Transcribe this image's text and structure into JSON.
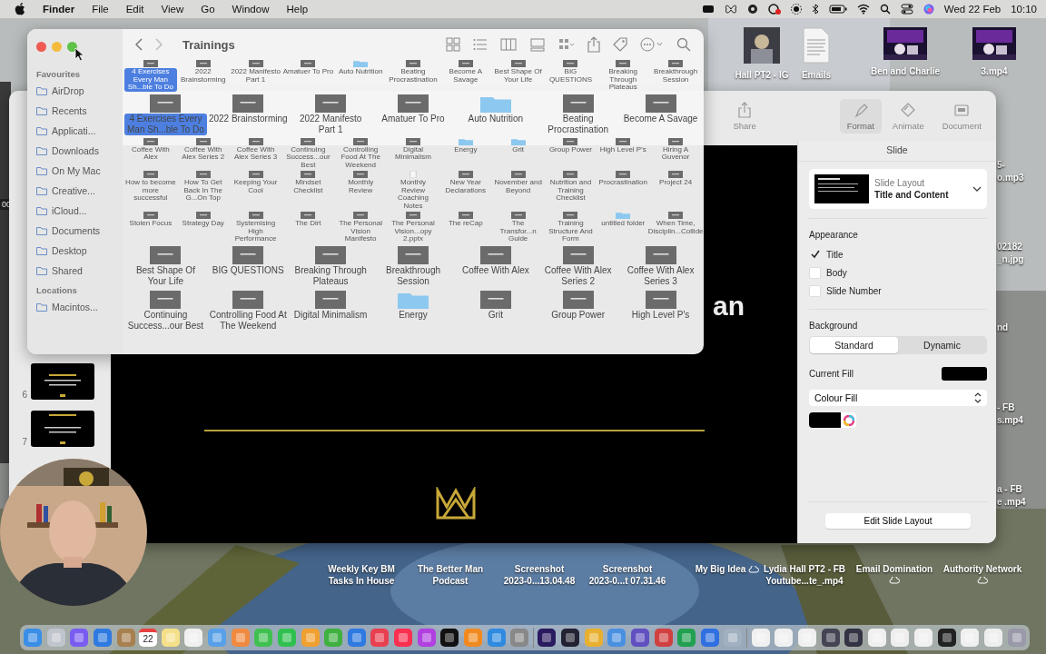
{
  "menu_bar": {
    "app_name": "Finder",
    "menus": [
      "File",
      "Edit",
      "View",
      "Go",
      "Window",
      "Help"
    ],
    "date": "Wed 22 Feb",
    "time": "10:10"
  },
  "desktop": {
    "top_icons": [
      {
        "label": "Hall PT2 - IG"
      },
      {
        "label": "Emails",
        "kind": "document"
      },
      {
        "label": "Ben and Charlie",
        "kind": "video"
      },
      {
        "label": "3.mp4",
        "kind": "video"
      }
    ],
    "edge_labels": [
      "5-",
      "o.mp3",
      "02182",
      "_n.jpg",
      "nd",
      "- FB",
      "s.mp4",
      "a - FB",
      "e .mp4"
    ],
    "left_edge_text": "00",
    "bottom_icons": [
      {
        "lines": [
          "Weekly Key BM",
          "Tasks In House"
        ],
        "cloud": false
      },
      {
        "lines": [
          "The Better Man",
          "Podcast"
        ],
        "cloud": false
      },
      {
        "lines": [
          "Screenshot",
          "2023-0...13.04.48"
        ],
        "cloud": false
      },
      {
        "lines": [
          "Screenshot",
          "2023-0...t 07.31.46"
        ],
        "cloud": false
      },
      {
        "lines": [
          "My Big Idea"
        ],
        "cloud": true
      },
      {
        "lines": [
          "Lydia Hall PT2 - FB",
          "Youtube...te_.mp4"
        ],
        "cloud": false
      },
      {
        "lines": [
          "Email Domination"
        ],
        "cloud": true
      },
      {
        "lines": [
          "Authority Network"
        ],
        "cloud": true
      }
    ]
  },
  "keynote": {
    "toolbar": [
      {
        "label": "Share",
        "selected": false
      },
      {
        "label": "Format",
        "selected": true
      },
      {
        "label": "Animate",
        "selected": false
      },
      {
        "label": "Document",
        "selected": false
      }
    ],
    "slide_numbers": [
      "6",
      "7"
    ],
    "canvas": {
      "title_fragment": "an"
    },
    "inspector": {
      "header": "Slide",
      "layout_label": "Slide Layout",
      "layout_name": "Title and Content",
      "appearance_heading": "Appearance",
      "appearance": [
        {
          "label": "Title",
          "checked": true
        },
        {
          "label": "Body",
          "checked": false
        },
        {
          "label": "Slide Number",
          "checked": false
        }
      ],
      "background_heading": "Background",
      "background_modes": [
        {
          "label": "Standard",
          "selected": true
        },
        {
          "label": "Dynamic",
          "selected": false
        }
      ],
      "current_fill_label": "Current Fill",
      "fill_type": "Colour Fill",
      "edit_button": "Edit Slide Layout"
    }
  },
  "finder": {
    "title": "Trainings",
    "sidebar": [
      {
        "label": "Favourites",
        "kind": "heading"
      },
      {
        "label": "AirDrop",
        "kind": "item"
      },
      {
        "label": "Recents",
        "kind": "item"
      },
      {
        "label": "Applicati...",
        "kind": "item"
      },
      {
        "label": "Downloads",
        "kind": "item"
      },
      {
        "label": "On My Mac",
        "kind": "item"
      },
      {
        "label": "Creative...",
        "kind": "item"
      },
      {
        "label": "iCloud...",
        "kind": "item"
      },
      {
        "label": "Documents",
        "kind": "item"
      },
      {
        "label": "Desktop",
        "kind": "item"
      },
      {
        "label": "Shared",
        "kind": "item"
      },
      {
        "label": "Locations",
        "kind": "heading"
      },
      {
        "label": "Macintos...",
        "kind": "item"
      }
    ],
    "small_rows": [
      [
        {
          "label": "4 Exercises Every Man Sh...ble To Do",
          "kind": "presentation",
          "selected": true
        },
        {
          "label": "2022 Brainstorming",
          "kind": "presentation",
          "selected": false
        },
        {
          "label": "2022 Manifesto Part 1",
          "kind": "presentation",
          "selected": false
        },
        {
          "label": "Amatuer To Pro",
          "kind": "presentation",
          "selected": false
        },
        {
          "label": "Auto Nutrition",
          "kind": "folder",
          "selected": false
        },
        {
          "label": "Beating Procrastination",
          "kind": "presentation",
          "selected": false
        },
        {
          "label": "Become A Savage",
          "kind": "presentation",
          "selected": false
        },
        {
          "label": "Best Shape Of Your Life",
          "kind": "presentation",
          "selected": false
        },
        {
          "label": "BIG QUESTIONS",
          "kind": "presentation",
          "selected": false
        },
        {
          "label": "Breaking Through Plateaus",
          "kind": "presentation",
          "selected": false
        },
        {
          "label": "Breakthrough Session",
          "kind": "presentation",
          "selected": false
        }
      ],
      [
        {
          "label": "Coffee With Alex",
          "kind": "presentation",
          "selected": false
        },
        {
          "label": "Coffee With Alex Series 2",
          "kind": "presentation",
          "selected": false
        },
        {
          "label": "Coffee With Alex Series 3",
          "kind": "presentation",
          "selected": false
        },
        {
          "label": "Continuing Success...our Best",
          "kind": "presentation",
          "selected": false
        },
        {
          "label": "Controlling Food At The Weekend",
          "kind": "presentation",
          "selected": false
        },
        {
          "label": "Digital Minimalism",
          "kind": "presentation",
          "selected": false
        },
        {
          "label": "Energy",
          "kind": "folder",
          "selected": false
        },
        {
          "label": "Grit",
          "kind": "folder",
          "selected": false
        },
        {
          "label": "Group Power",
          "kind": "presentation",
          "selected": false
        },
        {
          "label": "High Level P's",
          "kind": "presentation",
          "selected": false
        },
        {
          "label": "Hiring A Guvenor",
          "kind": "presentation",
          "selected": false
        }
      ],
      [
        {
          "label": "How to become more successful",
          "kind": "presentation",
          "selected": false
        },
        {
          "label": "How To Get Back In The G...On Top",
          "kind": "presentation",
          "selected": false
        },
        {
          "label": "Keeping Your Cool",
          "kind": "presentation",
          "selected": false
        },
        {
          "label": "Mindset Checklist",
          "kind": "presentation",
          "selected": false
        },
        {
          "label": "Monthly Review",
          "kind": "presentation",
          "selected": false
        },
        {
          "label": "Monthly Review Coaching Notes",
          "kind": "document",
          "selected": false
        },
        {
          "label": "New Year Declarations",
          "kind": "presentation",
          "selected": false
        },
        {
          "label": "November and Beyond",
          "kind": "presentation",
          "selected": false
        },
        {
          "label": "Nutrition and Training Checklist",
          "kind": "presentation",
          "selected": false
        },
        {
          "label": "Procrastination",
          "kind": "presentation",
          "selected": false
        },
        {
          "label": "Project 24",
          "kind": "presentation",
          "selected": false
        }
      ],
      [
        {
          "label": "Stolen Focus",
          "kind": "presentation",
          "selected": false
        },
        {
          "label": "Strategy Day",
          "kind": "presentation",
          "selected": false
        },
        {
          "label": "Systemising High Performance",
          "kind": "presentation",
          "selected": false
        },
        {
          "label": "The Dirt",
          "kind": "presentation",
          "selected": false
        },
        {
          "label": "The Personal Vision Manifesto",
          "kind": "presentation",
          "selected": false
        },
        {
          "label": "The Personal Vision...opy 2.pptx",
          "kind": "presentation",
          "selected": false
        },
        {
          "label": "The reCap",
          "kind": "presentation",
          "selected": false
        },
        {
          "label": "The Transfor...n Guide",
          "kind": "presentation",
          "selected": false
        },
        {
          "label": "Training Structure And Form",
          "kind": "presentation",
          "selected": false
        },
        {
          "label": "untitled folder",
          "kind": "folder",
          "selected": false
        },
        {
          "label": "When Time, Disciplin...Collide",
          "kind": "presentation",
          "selected": false
        }
      ]
    ],
    "big_rows": [
      [
        {
          "label": "4 Exercises Every Man Sh...ble To Do",
          "kind": "presentation",
          "selected": true
        },
        {
          "label": "2022 Brainstorming",
          "kind": "presentation",
          "selected": false
        },
        {
          "label": "2022 Manifesto Part 1",
          "kind": "presentation",
          "selected": false
        },
        {
          "label": "Amatuer To Pro",
          "kind": "presentation",
          "selected": false
        },
        {
          "label": "Auto Nutrition",
          "kind": "folder",
          "selected": false
        },
        {
          "label": "Beating Procrastination",
          "kind": "presentation",
          "selected": false
        },
        {
          "label": "Become A Savage",
          "kind": "presentation",
          "selected": false
        }
      ],
      [
        {
          "label": "Best Shape Of Your Life",
          "kind": "presentation",
          "selected": false
        },
        {
          "label": "BIG QUESTIONS",
          "kind": "presentation",
          "selected": false
        },
        {
          "label": "Breaking Through Plateaus",
          "kind": "presentation",
          "selected": false
        },
        {
          "label": "Breakthrough Session",
          "kind": "presentation",
          "selected": false
        },
        {
          "label": "Coffee With Alex",
          "kind": "presentation",
          "selected": false
        },
        {
          "label": "Coffee With Alex Series 2",
          "kind": "presentation",
          "selected": false
        },
        {
          "label": "Coffee With Alex Series 3",
          "kind": "presentation",
          "selected": false
        }
      ],
      [
        {
          "label": "Continuing Success...our Best",
          "kind": "presentation",
          "selected": false
        },
        {
          "label": "Controlling Food At The Weekend",
          "kind": "presentation",
          "selected": false
        },
        {
          "label": "Digital Minimalism",
          "kind": "presentation",
          "selected": false
        },
        {
          "label": "Energy",
          "kind": "folder",
          "selected": false
        },
        {
          "label": "Grit",
          "kind": "presentation",
          "selected": false
        },
        {
          "label": "Group Power",
          "kind": "presentation",
          "selected": false
        },
        {
          "label": "High Level P's",
          "kind": "presentation",
          "selected": false
        }
      ]
    ]
  },
  "dock": {
    "calendar_date": "22"
  }
}
